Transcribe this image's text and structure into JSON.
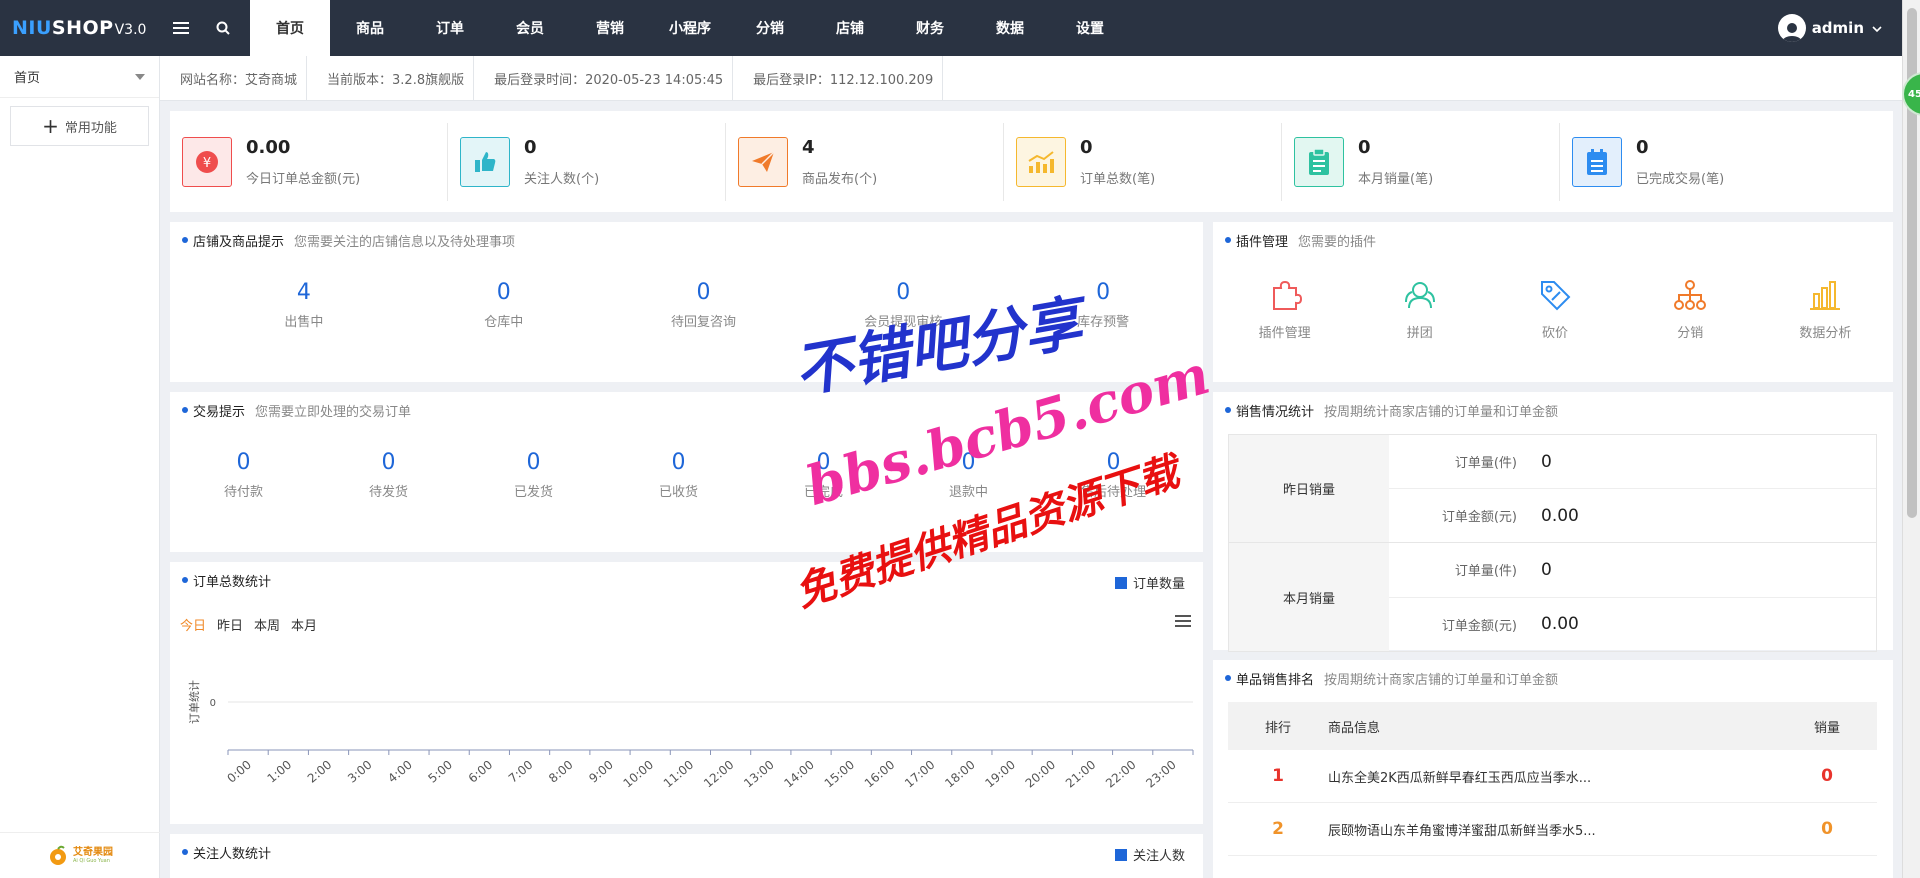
{
  "app": {
    "logo_a": "NIU",
    "logo_b": "SHOP",
    "logo_version": "V3.0",
    "menu_icon": "hamburger-icon",
    "search_icon": "search-icon"
  },
  "nav": {
    "items": [
      {
        "label": "首页"
      },
      {
        "label": "商品"
      },
      {
        "label": "订单"
      },
      {
        "label": "会员"
      },
      {
        "label": "营销"
      },
      {
        "label": "小程序"
      },
      {
        "label": "分销"
      },
      {
        "label": "店铺"
      },
      {
        "label": "财务"
      },
      {
        "label": "数据"
      },
      {
        "label": "设置"
      }
    ],
    "active": 0
  },
  "user": {
    "name": "admin"
  },
  "sidebar": {
    "select_value": "首页",
    "favorites_label": "常用功能",
    "footer_logo": "艾奇果园",
    "footer_logo_sub": "Ai Qi Guo Yuan"
  },
  "infobar": {
    "site_name": "网站名称：艾奇商城",
    "version": "当前版本：3.2.8旗舰版",
    "last_login_time": "最后登录时间：2020-05-23 14:05:45",
    "last_login_ip": "最后登录IP：112.12.100.209"
  },
  "stats": [
    {
      "value": "0.00",
      "label": "今日订单总金额(元)",
      "icon": "yen-icon",
      "color": "#ef4d4d",
      "bg": "#fde8e8"
    },
    {
      "value": "0",
      "label": "关注人数(个)",
      "icon": "thumbs-up-icon",
      "color": "#2fb5c9",
      "bg": "#e3f5f8"
    },
    {
      "value": "4",
      "label": "商品发布(个)",
      "icon": "paper-plane-icon",
      "color": "#f07a2a",
      "bg": "#fdeee3"
    },
    {
      "value": "0",
      "label": "订单总数(笔)",
      "icon": "trend-chart-icon",
      "color": "#f5b82e",
      "bg": "#fdf5e1"
    },
    {
      "value": "0",
      "label": "本月销量(笔)",
      "icon": "clipboard-icon",
      "color": "#2ec2a0",
      "bg": "#e2f7f1"
    },
    {
      "value": "0",
      "label": "已完成交易(笔)",
      "icon": "list-doc-icon",
      "color": "#2d8cf0",
      "bg": "#e3effc"
    }
  ],
  "store_tips": {
    "title": "店铺及商品提示",
    "subtitle": "您需要关注的店铺信息以及待处理事项",
    "items": [
      {
        "value": "4",
        "label": "出售中"
      },
      {
        "value": "0",
        "label": "仓库中"
      },
      {
        "value": "0",
        "label": "待回复咨询"
      },
      {
        "value": "0",
        "label": "会员提现审核"
      },
      {
        "value": "0",
        "label": "库存预警"
      }
    ]
  },
  "plugins": {
    "title": "插件管理",
    "subtitle": "您需要的插件",
    "items": [
      {
        "label": "插件管理",
        "icon": "puzzle-icon",
        "color": "#ef5a5a"
      },
      {
        "label": "拼团",
        "icon": "group-icon",
        "color": "#2ec2a0"
      },
      {
        "label": "砍价",
        "icon": "price-tag-icon",
        "color": "#2d8cf0"
      },
      {
        "label": "分销",
        "icon": "distribution-icon",
        "color": "#f07a2a"
      },
      {
        "label": "数据分析",
        "icon": "bar-chart-icon",
        "color": "#f5b82e"
      }
    ]
  },
  "trade_tips": {
    "title": "交易提示",
    "subtitle": "您需要立即处理的交易订单",
    "items": [
      {
        "value": "0",
        "label": "待付款"
      },
      {
        "value": "0",
        "label": "待发货"
      },
      {
        "value": "0",
        "label": "已发货"
      },
      {
        "value": "0",
        "label": "已收货"
      },
      {
        "value": "0",
        "label": "已完成"
      },
      {
        "value": "0",
        "label": "退款中"
      },
      {
        "value": "0",
        "label": "售后待处理"
      }
    ]
  },
  "sales_stats": {
    "title": "销售情况统计",
    "subtitle": "按周期统计商家店铺的订单量和订单金额",
    "rows": [
      {
        "name": "昨日销量",
        "order_count_label": "订单量(件)",
        "order_count": "0",
        "order_amount_label": "订单金额(元)",
        "order_amount": "0.00"
      },
      {
        "name": "本月销量",
        "order_count_label": "订单量(件)",
        "order_count": "0",
        "order_amount_label": "订单金额(元)",
        "order_amount": "0.00"
      }
    ]
  },
  "order_chart": {
    "title": "订单总数统计",
    "legend": "订单数量",
    "tabs": [
      "今日",
      "昨日",
      "本周",
      "本月"
    ],
    "active_tab": 0,
    "menu_icon": "menu-lines-icon"
  },
  "ranking": {
    "title": "单品销售排名",
    "subtitle": "按周期统计商家店铺的订单量和订单金额",
    "headers": {
      "rank": "排行",
      "info": "商品信息",
      "sales": "销量"
    },
    "rows": [
      {
        "rank": "1",
        "name": "山东全美2K西瓜新鲜早春红玉西瓜应当季水...",
        "sales": "0",
        "color": "#e8332c"
      },
      {
        "rank": "2",
        "name": "辰颐物语山东羊角蜜博洋蜜甜瓜新鲜当季水5...",
        "sales": "0",
        "color": "#f0932a"
      }
    ]
  },
  "follow_chart": {
    "title": "关注人数统计",
    "legend": "关注人数"
  },
  "watermark": {
    "line1": "不错吧分享",
    "line2": "bbs.bcb5.com",
    "line3": "免费提供精品资源下载"
  },
  "badge": {
    "text": "45"
  },
  "chart_data": {
    "type": "line",
    "title": "",
    "ylabel": "订单统计",
    "xlabel": "",
    "x": [
      "0:00",
      "1:00",
      "2:00",
      "3:00",
      "4:00",
      "5:00",
      "6:00",
      "7:00",
      "8:00",
      "9:00",
      "10:00",
      "11:00",
      "12:00",
      "13:00",
      "14:00",
      "15:00",
      "16:00",
      "17:00",
      "18:00",
      "19:00",
      "20:00",
      "21:00",
      "22:00",
      "23:00"
    ],
    "series": [
      {
        "name": "订单数量",
        "values": [
          0,
          0,
          0,
          0,
          0,
          0,
          0,
          0,
          0,
          0,
          0,
          0,
          0,
          0,
          0,
          0,
          0,
          0,
          0,
          0,
          0,
          0,
          0,
          0
        ]
      }
    ],
    "yticks": [
      "0"
    ],
    "grid": true,
    "legend": "top-right"
  }
}
